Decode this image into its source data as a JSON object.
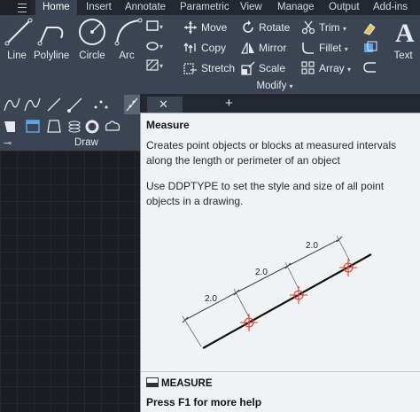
{
  "ribbon_tabs": [
    "Home",
    "Insert",
    "Annotate",
    "Parametric",
    "View",
    "Manage",
    "Output",
    "Add-ins"
  ],
  "active_tab": "Home",
  "draw_tools": {
    "line": "Line",
    "polyline": "Polyline",
    "circle": "Circle",
    "arc": "Arc"
  },
  "modify_tools": {
    "move": "Move",
    "rotate": "Rotate",
    "trim": "Trim",
    "copy": "Copy",
    "mirror": "Mirror",
    "fillet": "Fillet",
    "stretch": "Stretch",
    "scale": "Scale",
    "array": "Array"
  },
  "text_tool": "Text",
  "panels": {
    "draw": "Draw",
    "modify": "Modify"
  },
  "tooltip": {
    "title": "Measure",
    "description": "Creates point objects or blocks at measured intervals along the length or perimeter of an object",
    "detail": "Use DDPTYPE to set the style and size of all point objects in a drawing.",
    "command": "MEASURE",
    "help": "Press F1 for more help",
    "dimension_labels": [
      "2.0",
      "2.0",
      "2.0"
    ]
  },
  "colors": {
    "ribbon_bg": "#3b4452",
    "tabbar_bg": "#232830",
    "tooltip_bg": "#f1f2f4",
    "marker_red": "#e0392b"
  }
}
